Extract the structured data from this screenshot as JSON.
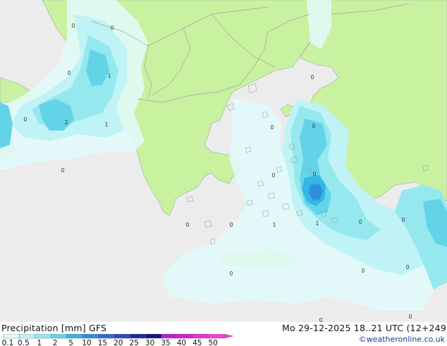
{
  "header": {
    "title": "Precipitation [mm]  GFS",
    "datetime": "Mo 29-12-2025  18..21 UTC (12+249",
    "credit": "©weatheronline.co.uk"
  },
  "legend": {
    "labels": [
      "0.1",
      "0.5",
      "1",
      "2",
      "5",
      "10",
      "15",
      "20",
      "25",
      "30",
      "35",
      "40",
      "45",
      "50"
    ],
    "colors": [
      "#e2fbfb",
      "#bff3f6",
      "#96e8ef",
      "#63d4e8",
      "#34b6e3",
      "#2c8fe0",
      "#2f6ad8",
      "#2e46c2",
      "#1e2aa0",
      "#15157a",
      "#b51fd8",
      "#d41fd6",
      "#e832d6",
      "#f045d6"
    ]
  },
  "map": {
    "colors": {
      "sea": "#ececec",
      "land": "#c8f2a0",
      "border": "#a5a5a5"
    },
    "labels": [
      {
        "text": "0"
      },
      {
        "text": "0"
      },
      {
        "text": "1"
      },
      {
        "text": "0"
      },
      {
        "text": "2"
      },
      {
        "text": "1"
      },
      {
        "text": "0"
      },
      {
        "text": "0"
      },
      {
        "text": "0"
      },
      {
        "text": "0"
      },
      {
        "text": "0"
      },
      {
        "text": "0"
      },
      {
        "text": "0"
      },
      {
        "text": "0"
      },
      {
        "text": "0"
      },
      {
        "text": "1"
      },
      {
        "text": "1"
      },
      {
        "text": "0"
      },
      {
        "text": "0"
      },
      {
        "text": "0"
      },
      {
        "text": "0"
      },
      {
        "text": "0"
      },
      {
        "text": "0"
      },
      {
        "text": "0"
      }
    ]
  }
}
